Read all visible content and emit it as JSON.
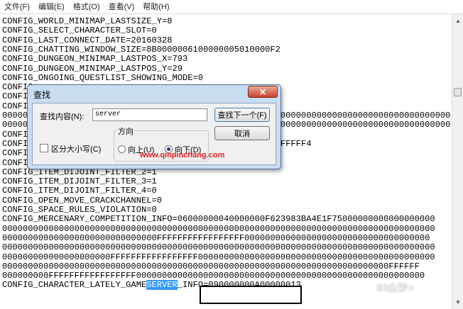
{
  "menu": {
    "items": [
      "文件(F)",
      "编辑(E)",
      "格式(O)",
      "查看(V)",
      "帮助(H)"
    ]
  },
  "editor": {
    "lines": [
      "CONFIG_WORLD_MINIMAP_LASTSIZE_Y=8",
      "CONFIG_SELECT_CHARACTER_SLOT=0",
      "CONFIG_LAST_CONNECT_DATE=20160328",
      "CONFIG_CHATTING_WINDOW_SIZE=8B0000006100000005010000F2",
      "CONFIG_DUNGEON_MINIMAP_LASTPOS_X=793",
      "CONFIG_DUNGEON_MINIMAP_LASTPOS_Y=29",
      "CONFIG_ONGOING_QUESTLIST_SHOWING_MODE=0",
      "CONFIG_",
      "CONFIG_",
      "CONFIG_",
      "000000                                             000000000000000000000000000000000000",
      "000000                                             000000000000000000000000000000000000",
      "CONFIG_",
      "CONFIG_                                            FFFFFFFF4",
      "CONFIG_",
      "CONFIG_ITEM_DIJOINT_FILTER_1=1",
      "CONFIG_ITEM_DIJOINT_FILTER_2=1",
      "CONFIG_ITEM_DIJOINT_FILTER_3=1",
      "CONFIG_ITEM_DIJOINT_FILTER_4=0",
      "CONFIG_OPEN_MOVE_CRACKCHANNEL=0",
      "CONFIG_SPACE_RULES_VIOLATION=0",
      "CONFIG_MERCENARY_COMPETITION_INFO=06000000040000000F623983BA4E1F75000000000000000000",
      "000000000000000000000000000000000000000000000000000000000000000000000000000000000000",
      "000000000000000000000000000000FFFFFFFFFFFFFFFFF000000000000000000000000000000000000",
      "000000000000000000000000000000000000000000000000000000000000000000000000000000000000",
      "000000000000000000000FFFFFFFFFFFFFFFFF0000000000000000000000000000000000000000000000",
      "000000000000000000000000000000000000000000000000000000000000000000000000000FFFFFF",
      "000000000FFFFFFFFFFFFFFFFF00000000000000000000000000000000000000000000000000000000"
    ],
    "last_line_prefix": "CONFIG_CHARACTER_LATELY_GAME",
    "last_line_highlight": "SERVER",
    "last_line_suffix": "_INFO=090000000A00000013"
  },
  "find_dialog": {
    "title": "查找",
    "close_label": "✕",
    "find_label": "查找内容(N):",
    "find_value": "server",
    "find_next_label": "查找下一个(F)",
    "cancel_label": "取消",
    "direction_label": "方向",
    "up_label": "向上(U)",
    "down_label": "向下(D)",
    "selected_direction": "down",
    "match_case_label": "区分大小写(C)",
    "match_case_checked": false,
    "watermark": "www.qinpinchang.com"
  },
  "logo": "Sl山沙●"
}
